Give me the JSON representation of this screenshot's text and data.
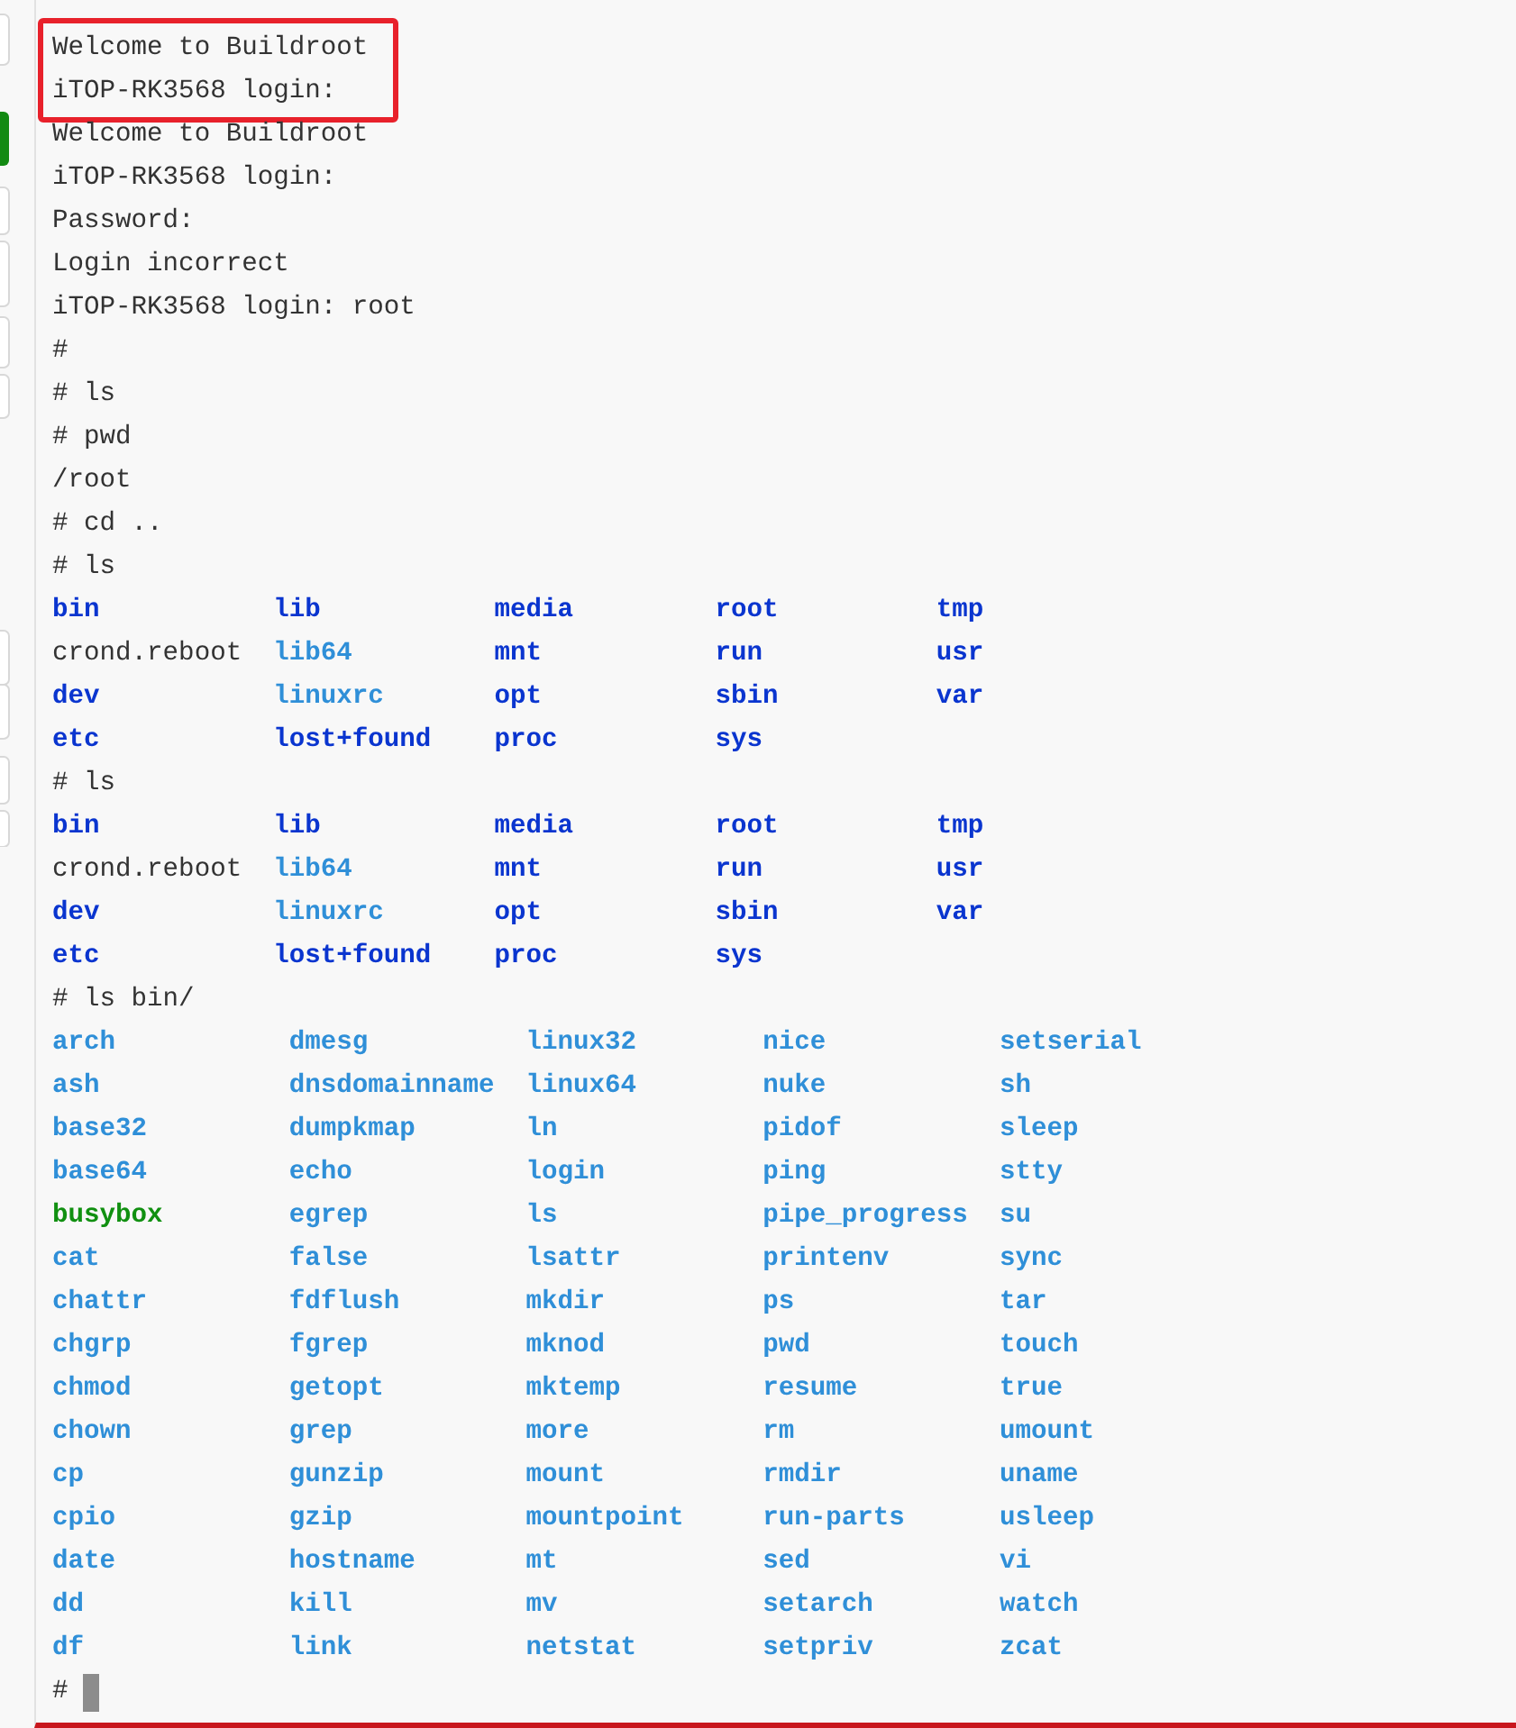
{
  "sections": [
    {
      "highlighted": true,
      "lines": [
        {
          "kind": "text",
          "text": "Welcome to Buildroot"
        },
        {
          "kind": "text",
          "text": "iTOP-RK3568 login:"
        }
      ]
    },
    {
      "lines": [
        {
          "kind": "text",
          "text": "Welcome to Buildroot"
        },
        {
          "kind": "text",
          "text": "iTOP-RK3568 login:"
        },
        {
          "kind": "text",
          "text": "Password:"
        },
        {
          "kind": "text",
          "text": "Login incorrect"
        },
        {
          "kind": "text",
          "text": "iTOP-RK3568 login: root"
        },
        {
          "kind": "text",
          "text": "#"
        },
        {
          "kind": "text",
          "text": "# ls"
        },
        {
          "kind": "text",
          "text": "# pwd"
        },
        {
          "kind": "text",
          "text": "/root"
        },
        {
          "kind": "text",
          "text": "# cd .."
        },
        {
          "kind": "text",
          "text": "# ls"
        },
        {
          "kind": "listing",
          "columns": [
            [
              {
                "name": "bin",
                "kind": "dir"
              },
              {
                "name": "crond.reboot",
                "kind": "file"
              },
              {
                "name": "dev",
                "kind": "dir"
              },
              {
                "name": "etc",
                "kind": "dir"
              }
            ],
            [
              {
                "name": "lib",
                "kind": "dir"
              },
              {
                "name": "lib64",
                "kind": "link"
              },
              {
                "name": "linuxrc",
                "kind": "link"
              },
              {
                "name": "lost+found",
                "kind": "dir"
              }
            ],
            [
              {
                "name": "media",
                "kind": "dir"
              },
              {
                "name": "mnt",
                "kind": "dir"
              },
              {
                "name": "opt",
                "kind": "dir"
              },
              {
                "name": "proc",
                "kind": "dir"
              }
            ],
            [
              {
                "name": "root",
                "kind": "dir"
              },
              {
                "name": "run",
                "kind": "dir"
              },
              {
                "name": "sbin",
                "kind": "dir"
              },
              {
                "name": "sys",
                "kind": "dir"
              }
            ],
            [
              {
                "name": "tmp",
                "kind": "dir"
              },
              {
                "name": "usr",
                "kind": "dir"
              },
              {
                "name": "var",
                "kind": "dir"
              }
            ]
          ]
        },
        {
          "kind": "text",
          "text": "# ls"
        },
        {
          "kind": "listing",
          "columns": [
            [
              {
                "name": "bin",
                "kind": "dir"
              },
              {
                "name": "crond.reboot",
                "kind": "file"
              },
              {
                "name": "dev",
                "kind": "dir"
              },
              {
                "name": "etc",
                "kind": "dir"
              }
            ],
            [
              {
                "name": "lib",
                "kind": "dir"
              },
              {
                "name": "lib64",
                "kind": "link"
              },
              {
                "name": "linuxrc",
                "kind": "link"
              },
              {
                "name": "lost+found",
                "kind": "dir"
              }
            ],
            [
              {
                "name": "media",
                "kind": "dir"
              },
              {
                "name": "mnt",
                "kind": "dir"
              },
              {
                "name": "opt",
                "kind": "dir"
              },
              {
                "name": "proc",
                "kind": "dir"
              }
            ],
            [
              {
                "name": "root",
                "kind": "dir"
              },
              {
                "name": "run",
                "kind": "dir"
              },
              {
                "name": "sbin",
                "kind": "dir"
              },
              {
                "name": "sys",
                "kind": "dir"
              }
            ],
            [
              {
                "name": "tmp",
                "kind": "dir"
              },
              {
                "name": "usr",
                "kind": "dir"
              },
              {
                "name": "var",
                "kind": "dir"
              }
            ]
          ]
        },
        {
          "kind": "text",
          "text": "# ls bin/"
        },
        {
          "kind": "listing",
          "columns": [
            [
              {
                "name": "arch",
                "kind": "link"
              },
              {
                "name": "ash",
                "kind": "link"
              },
              {
                "name": "base32",
                "kind": "link"
              },
              {
                "name": "base64",
                "kind": "link"
              },
              {
                "name": "busybox",
                "kind": "exec"
              },
              {
                "name": "cat",
                "kind": "link"
              },
              {
                "name": "chattr",
                "kind": "link"
              },
              {
                "name": "chgrp",
                "kind": "link"
              },
              {
                "name": "chmod",
                "kind": "link"
              },
              {
                "name": "chown",
                "kind": "link"
              },
              {
                "name": "cp",
                "kind": "link"
              },
              {
                "name": "cpio",
                "kind": "link"
              },
              {
                "name": "date",
                "kind": "link"
              },
              {
                "name": "dd",
                "kind": "link"
              },
              {
                "name": "df",
                "kind": "link"
              }
            ],
            [
              {
                "name": "dmesg",
                "kind": "link"
              },
              {
                "name": "dnsdomainname",
                "kind": "link"
              },
              {
                "name": "dumpkmap",
                "kind": "link"
              },
              {
                "name": "echo",
                "kind": "link"
              },
              {
                "name": "egrep",
                "kind": "link"
              },
              {
                "name": "false",
                "kind": "link"
              },
              {
                "name": "fdflush",
                "kind": "link"
              },
              {
                "name": "fgrep",
                "kind": "link"
              },
              {
                "name": "getopt",
                "kind": "link"
              },
              {
                "name": "grep",
                "kind": "link"
              },
              {
                "name": "gunzip",
                "kind": "link"
              },
              {
                "name": "gzip",
                "kind": "link"
              },
              {
                "name": "hostname",
                "kind": "link"
              },
              {
                "name": "kill",
                "kind": "link"
              },
              {
                "name": "link",
                "kind": "link"
              }
            ],
            [
              {
                "name": "linux32",
                "kind": "link"
              },
              {
                "name": "linux64",
                "kind": "link"
              },
              {
                "name": "ln",
                "kind": "link"
              },
              {
                "name": "login",
                "kind": "link"
              },
              {
                "name": "ls",
                "kind": "link"
              },
              {
                "name": "lsattr",
                "kind": "link"
              },
              {
                "name": "mkdir",
                "kind": "link"
              },
              {
                "name": "mknod",
                "kind": "link"
              },
              {
                "name": "mktemp",
                "kind": "link"
              },
              {
                "name": "more",
                "kind": "link"
              },
              {
                "name": "mount",
                "kind": "link"
              },
              {
                "name": "mountpoint",
                "kind": "link"
              },
              {
                "name": "mt",
                "kind": "link"
              },
              {
                "name": "mv",
                "kind": "link"
              },
              {
                "name": "netstat",
                "kind": "link"
              }
            ],
            [
              {
                "name": "nice",
                "kind": "link"
              },
              {
                "name": "nuke",
                "kind": "link"
              },
              {
                "name": "pidof",
                "kind": "link"
              },
              {
                "name": "ping",
                "kind": "link"
              },
              {
                "name": "pipe_progress",
                "kind": "link"
              },
              {
                "name": "printenv",
                "kind": "link"
              },
              {
                "name": "ps",
                "kind": "link"
              },
              {
                "name": "pwd",
                "kind": "link"
              },
              {
                "name": "resume",
                "kind": "link"
              },
              {
                "name": "rm",
                "kind": "link"
              },
              {
                "name": "rmdir",
                "kind": "link"
              },
              {
                "name": "run-parts",
                "kind": "link"
              },
              {
                "name": "sed",
                "kind": "link"
              },
              {
                "name": "setarch",
                "kind": "link"
              },
              {
                "name": "setpriv",
                "kind": "link"
              }
            ],
            [
              {
                "name": "setserial",
                "kind": "link"
              },
              {
                "name": "sh",
                "kind": "link"
              },
              {
                "name": "sleep",
                "kind": "link"
              },
              {
                "name": "stty",
                "kind": "link"
              },
              {
                "name": "su",
                "kind": "link"
              },
              {
                "name": "sync",
                "kind": "link"
              },
              {
                "name": "tar",
                "kind": "link"
              },
              {
                "name": "touch",
                "kind": "link"
              },
              {
                "name": "true",
                "kind": "link"
              },
              {
                "name": "umount",
                "kind": "link"
              },
              {
                "name": "uname",
                "kind": "link"
              },
              {
                "name": "usleep",
                "kind": "link"
              },
              {
                "name": "vi",
                "kind": "link"
              },
              {
                "name": "watch",
                "kind": "link"
              },
              {
                "name": "zcat",
                "kind": "link"
              }
            ]
          ]
        },
        {
          "kind": "prompt",
          "text": "#",
          "cursor": true
        }
      ]
    }
  ]
}
